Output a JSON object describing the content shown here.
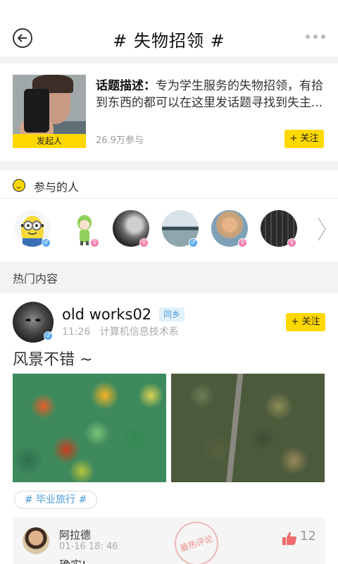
{
  "header": {
    "title": "# 失物招领 #"
  },
  "topic": {
    "badge": "发起人",
    "desc_label": "话题描述：",
    "desc_text": "专为学生服务的失物招领，有拾到东西的都可以在这里发话题寻找到失主...",
    "participants": "26.9万参与",
    "follow_label": "+ 关注"
  },
  "participants_section": {
    "title": "参与的人",
    "avatars": [
      {
        "name": "minion-avatar",
        "gender": "male"
      },
      {
        "name": "cartoon-girl-avatar",
        "gender": "female"
      },
      {
        "name": "profile-avatar-3",
        "gender": "female"
      },
      {
        "name": "lake-avatar",
        "gender": "male"
      },
      {
        "name": "child-avatar",
        "gender": "female"
      },
      {
        "name": "bench-avatar",
        "gender": "female"
      }
    ]
  },
  "hot_section": {
    "title": "热门内容"
  },
  "post": {
    "username": "old works02",
    "tag": "同乡",
    "time": "11:26",
    "department": "计算机信息技术系",
    "text": "风景不错 ~",
    "follow_label": "+ 关注",
    "hashtag": "# 毕业旅行 #"
  },
  "comment": {
    "name": "阿拉德",
    "time": "01-16  18: 46",
    "text": "确实!",
    "stamp": "最热评论",
    "likes": "12"
  },
  "colors": {
    "accent": "#ffd800",
    "male": "#5aa9f0",
    "female": "#f47fae",
    "link": "#4a9ad6"
  }
}
